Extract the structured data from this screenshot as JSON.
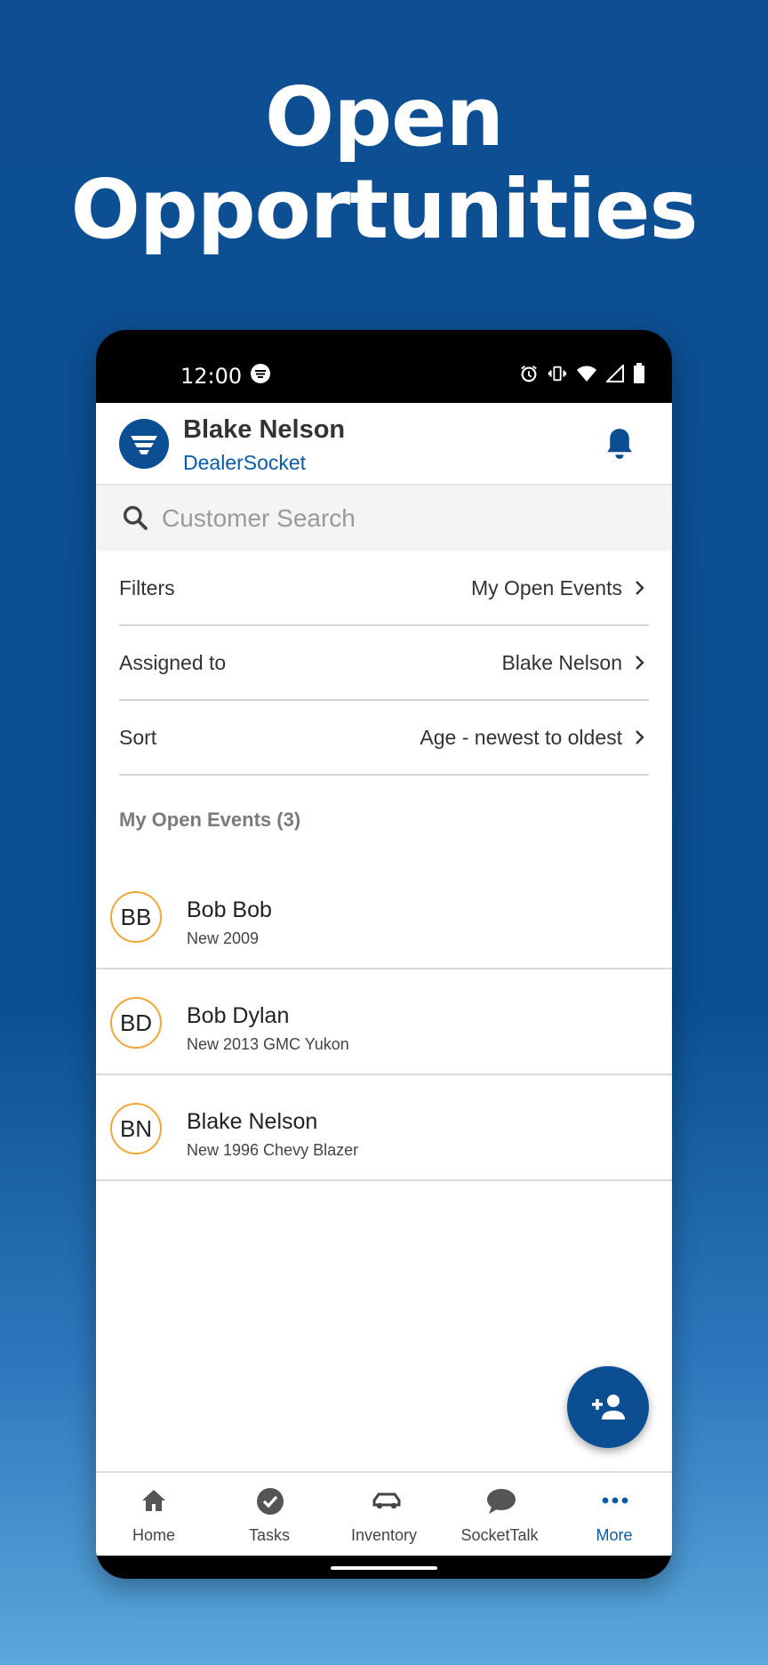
{
  "headline": {
    "line1": "Open",
    "line2": "Opportunities"
  },
  "status": {
    "time": "12:00"
  },
  "appbar": {
    "user_name": "Blake Nelson",
    "company": "DealerSocket"
  },
  "search": {
    "placeholder": "Customer Search"
  },
  "filters": [
    {
      "label": "Filters",
      "value": "My Open Events"
    },
    {
      "label": "Assigned to",
      "value": "Blake Nelson"
    },
    {
      "label": "Sort",
      "value": "Age - newest to oldest"
    }
  ],
  "events": {
    "title": "My Open Events (3)",
    "items": [
      {
        "initials": "BB",
        "name": "Bob Bob",
        "detail": "New 2009"
      },
      {
        "initials": "BD",
        "name": "Bob Dylan",
        "detail": "New 2013 GMC Yukon"
      },
      {
        "initials": "BN",
        "name": "Blake Nelson",
        "detail": "New 1996 Chevy Blazer"
      }
    ]
  },
  "tabs": [
    {
      "label": "Home",
      "icon": "home-icon"
    },
    {
      "label": "Tasks",
      "icon": "check-circle-icon"
    },
    {
      "label": "Inventory",
      "icon": "car-icon"
    },
    {
      "label": "SocketTalk",
      "icon": "chat-bubble-icon"
    },
    {
      "label": "More",
      "icon": "more-dots-icon",
      "active": true
    }
  ],
  "colors": {
    "brand": "#0b4f92",
    "accent": "#0b5aa7",
    "avatar_ring": "#f0a638"
  }
}
